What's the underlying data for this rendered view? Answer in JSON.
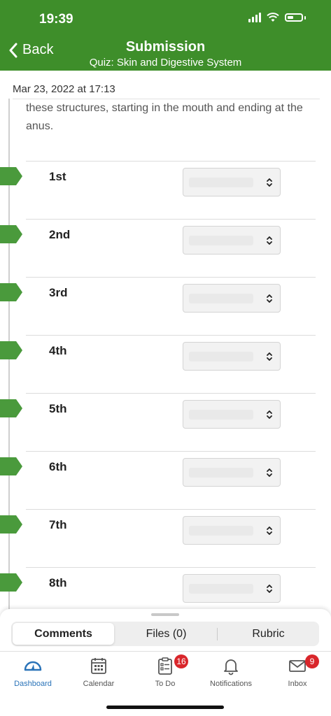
{
  "status": {
    "time": "19:39"
  },
  "header": {
    "back_label": "Back",
    "title": "Submission",
    "subtitle": "Quiz:  Skin and Digestive System",
    "color": "#3e8e2a"
  },
  "content": {
    "date": "Mar 23, 2022 at 17:13",
    "question_text": "these structures, starting in the mouth and ending at the anus.",
    "rows": [
      {
        "label": "1st"
      },
      {
        "label": "2nd"
      },
      {
        "label": "3rd"
      },
      {
        "label": "4th"
      },
      {
        "label": "5th"
      },
      {
        "label": "6th"
      },
      {
        "label": "7th"
      },
      {
        "label": "8th"
      }
    ]
  },
  "sheet": {
    "tabs": [
      {
        "label": "Comments",
        "active": true
      },
      {
        "label": "Files (0)",
        "active": false
      },
      {
        "label": "Rubric",
        "active": false
      }
    ]
  },
  "tabbar": {
    "items": [
      {
        "label": "Dashboard",
        "icon": "dashboard-icon",
        "active": true
      },
      {
        "label": "Calendar",
        "icon": "calendar-icon"
      },
      {
        "label": "To Do",
        "icon": "todo-icon",
        "badge": "16"
      },
      {
        "label": "Notifications",
        "icon": "bell-icon"
      },
      {
        "label": "Inbox",
        "icon": "inbox-icon",
        "badge": "9"
      }
    ],
    "active_color": "#2a73b8",
    "badge_color": "#d9262b"
  }
}
